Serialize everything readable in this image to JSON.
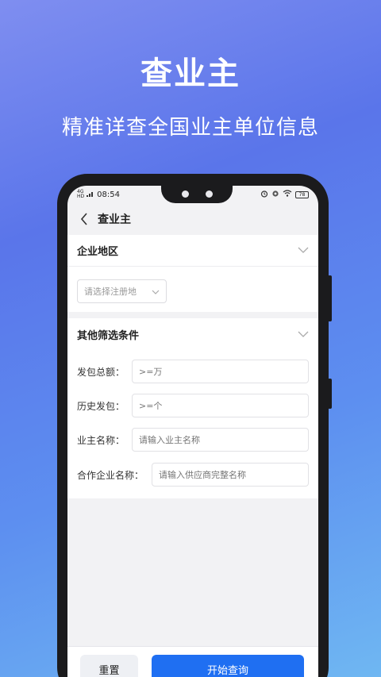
{
  "promo": {
    "title": "查业主",
    "subtitle": "精准详查全国业主单位信息"
  },
  "status_bar": {
    "signal_label": "4G",
    "hd_label": "HD",
    "time": "08:54",
    "battery": "78"
  },
  "nav": {
    "title": "查业主"
  },
  "region_section": {
    "title": "企业地区",
    "select_placeholder": "请选择注册地"
  },
  "filter_section": {
    "title": "其他筛选条件",
    "fields": [
      {
        "label": "发包总额：",
        "placeholder": ">=万"
      },
      {
        "label": "历史发包：",
        "placeholder": ">=个"
      },
      {
        "label": "业主名称：",
        "placeholder": "请输入业主名称"
      },
      {
        "label": "合作企业名称：",
        "placeholder": "请输入供应商完整名称"
      }
    ]
  },
  "actions": {
    "reset_label": "重置",
    "query_label": "开始查询"
  },
  "colors": {
    "primary": "#1f6ff2",
    "background_top": "#7f8ef0",
    "background_bottom": "#6fb7f2"
  }
}
